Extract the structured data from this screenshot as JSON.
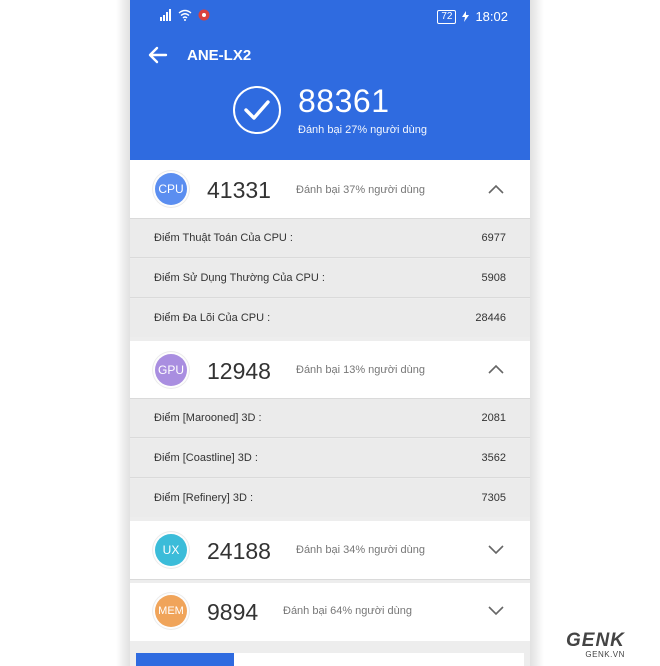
{
  "status_bar": {
    "battery": "72",
    "time": "18:02"
  },
  "header": {
    "device": "ANE-LX2",
    "total_score": "88361",
    "total_subtitle": "Đánh bại 27% người dùng"
  },
  "categories": [
    {
      "badge": "CPU",
      "score": "41331",
      "subtitle": "Đánh bại 37% người dùng",
      "color": "#5b8ef0",
      "expanded": true,
      "rows": [
        {
          "label": "Điểm Thuật Toán Của CPU :",
          "value": "6977"
        },
        {
          "label": "Điểm Sử Dụng Thường Của CPU :",
          "value": "5908"
        },
        {
          "label": "Điểm Đa Lõi Của CPU :",
          "value": "28446"
        }
      ]
    },
    {
      "badge": "GPU",
      "score": "12948",
      "subtitle": "Đánh bại 13% người dùng",
      "color": "#a98ee0",
      "expanded": true,
      "rows": [
        {
          "label": "Điểm [Marooned] 3D :",
          "value": "2081"
        },
        {
          "label": "Điểm [Coastline] 3D :",
          "value": "3562"
        },
        {
          "label": "Điểm [Refinery] 3D :",
          "value": "7305"
        }
      ]
    },
    {
      "badge": "UX",
      "score": "24188",
      "subtitle": "Đánh bại 34% người dùng",
      "color": "#3bbcd9",
      "expanded": false,
      "rows": []
    },
    {
      "badge": "MEM",
      "score": "9894",
      "subtitle": "Đánh bại 64% người dùng",
      "color": "#f0a45a",
      "expanded": false,
      "rows": []
    }
  ],
  "watermark": {
    "brand": "GENK",
    "site": "GENK.VN"
  },
  "colors": {
    "header_blue": "#2f6be0"
  }
}
